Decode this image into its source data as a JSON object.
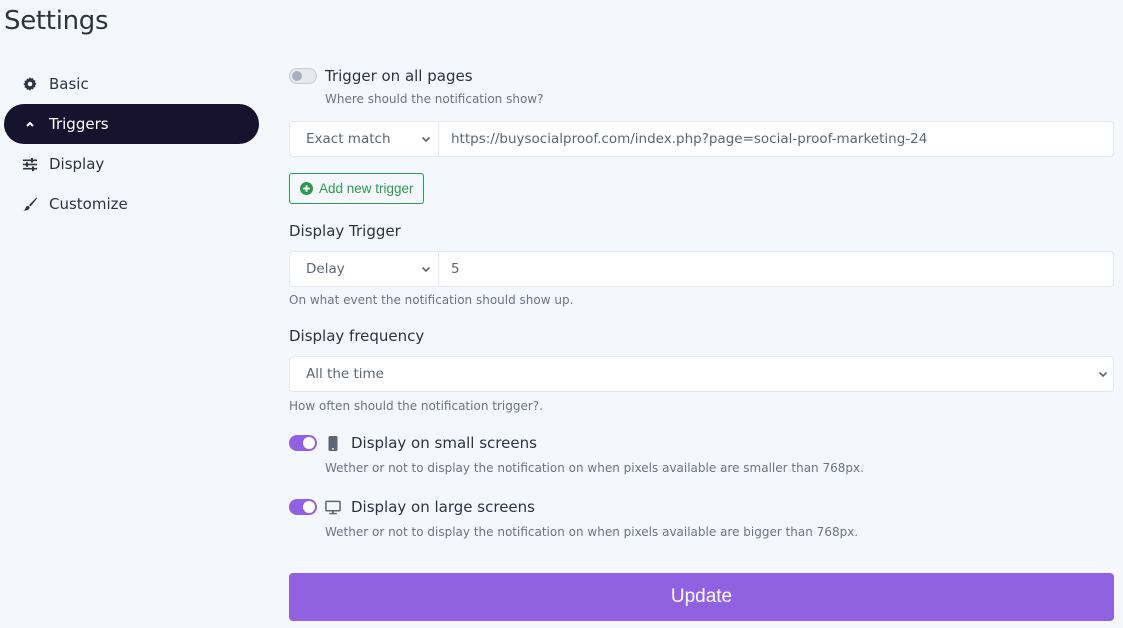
{
  "page": {
    "title": "Settings"
  },
  "sidebar": {
    "items": [
      {
        "label": "Basic",
        "icon": "gear-icon",
        "active": false
      },
      {
        "label": "Triggers",
        "icon": "chevron-up-icon",
        "active": true
      },
      {
        "label": "Display",
        "icon": "sliders-icon",
        "active": false
      },
      {
        "label": "Customize",
        "icon": "paintbrush-icon",
        "active": false
      }
    ]
  },
  "triggers": {
    "all_pages": {
      "label": "Trigger on all pages",
      "enabled": false,
      "help": "Where should the notification show?"
    },
    "rule": {
      "match_type": "Exact match",
      "url": "https://buysocialproof.com/index.php?page=social-proof-marketing-24"
    },
    "add_trigger_label": "Add new trigger"
  },
  "display_trigger": {
    "label": "Display Trigger",
    "type": "Delay",
    "value": "5",
    "help": "On what event the notification should show up."
  },
  "display_frequency": {
    "label": "Display frequency",
    "value": "All the time",
    "help": "How often should the notification trigger?."
  },
  "small_screens": {
    "label": "Display on small screens",
    "enabled": true,
    "help": "Wether or not to display the notification on when pixels available are smaller than 768px."
  },
  "large_screens": {
    "label": "Display on large screens",
    "enabled": true,
    "help": "Wether or not to display the notification on when pixels available are bigger than 768px."
  },
  "actions": {
    "update_label": "Update"
  },
  "colors": {
    "accent": "#9061e0",
    "sidebar_active": "#17132f",
    "success": "#2e9a4e",
    "background": "#f4f7fc"
  }
}
